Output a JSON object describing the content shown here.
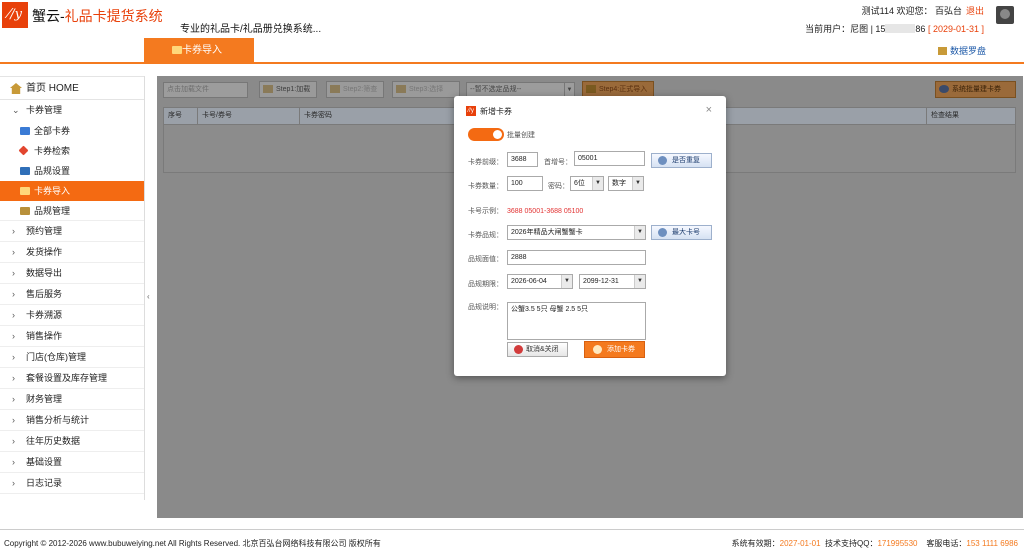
{
  "header": {
    "logo_mark": "⁄/y",
    "app_name_prefix": "蟹云-",
    "app_name_accent": "礼品卡提货系统",
    "slogan": "专业的礼品卡/礼品册兑换系统...",
    "user_greeting": "测试114 欢迎您： 百弘台",
    "logout_label": "退出",
    "current_user_prefix": "当前用户：尼图 | 15",
    "current_user_suffix": "86",
    "expiry": "[ 2029-01-31 ]",
    "main_tab_label": "卡券导入",
    "data_dashboard_label": "数据罗盘"
  },
  "sidebar": {
    "home_label": "首页 HOME",
    "card_mgmt_label": "卡券管理",
    "sub_items": [
      {
        "label": "全部卡券",
        "icon": "card-icon",
        "color": "#3a7bd5",
        "active": false
      },
      {
        "label": "卡券检索",
        "icon": "tag-icon",
        "color": "#e2462f",
        "active": false
      },
      {
        "label": "品规设置",
        "icon": "grid-icon",
        "color": "#2f6fb8",
        "active": false
      },
      {
        "label": "卡券导入",
        "icon": "folder-icon",
        "color": "#ffd87a",
        "active": true
      },
      {
        "label": "品规管理",
        "icon": "list-icon",
        "color": "#b8903a",
        "active": false
      }
    ],
    "groups": [
      "预约管理",
      "发货操作",
      "数据导出",
      "售后服务",
      "卡券溯源",
      "销售操作",
      "门店(仓库)管理",
      "套餐设置及库存管理",
      "财务管理",
      "销售分析与统计",
      "往年历史数据",
      "基础设置",
      "日志记录"
    ]
  },
  "toolbar": {
    "file_placeholder": "点击加载文件",
    "step1": "Step1:加载",
    "step2": "Step2:筛查",
    "step3": "Step3:选择",
    "category_select": "--暂不选定品规--",
    "step4": "Step4:正式导入",
    "right_button": "系统批量建卡券"
  },
  "table": {
    "columns": [
      "序号",
      "卡号/券号",
      "卡券密码",
      "检查结果"
    ]
  },
  "modal": {
    "logo_mark": "⁄/y",
    "title": "新增卡券",
    "close": "×",
    "toggle_label": "批量创建",
    "prefix_label": "卡券前缀：",
    "prefix_value": "3688",
    "start_label": "首增号：",
    "start_value": "05001",
    "check_dup_label": "是否重复",
    "qty_label": "卡券数量：",
    "qty_value": "100",
    "pwd_label": "密码：",
    "pwd_len": "6位",
    "pwd_type": "数字",
    "example_label": "卡号示例：",
    "example_value": "3688 05001-3688 05100",
    "category_label": "卡券品规：",
    "category_value": "2026年精品大闸蟹蟹卡",
    "max_card_label": "最大卡号",
    "face_label": "品规面值：",
    "face_value": "2888",
    "period_label": "品规期限：",
    "period_start": "2026-06-04",
    "period_end": "2099-12-31",
    "desc_label": "品规说明：",
    "desc_value": "公蟹3.5 5只 母蟹 2.5 5只",
    "cancel_label": "取消&关闭",
    "add_label": "添加卡券"
  },
  "footer": {
    "copyright": "Copyright © 2012-2026 www.bubuweiying.net All Rights Reserved. 北京百弘台网络科技有限公司 版权所有",
    "validity_label": "系统有效期：",
    "validity_value": "2027-01-01",
    "qq_label": "技术支持QQ：",
    "qq_value": "171995530",
    "phone_label": "客服电话：",
    "phone_value": "153 1111 6986"
  },
  "colors": {
    "accent": "#f47a1f",
    "active_sidebar": "#f46a12",
    "brand": "#e8400a"
  }
}
